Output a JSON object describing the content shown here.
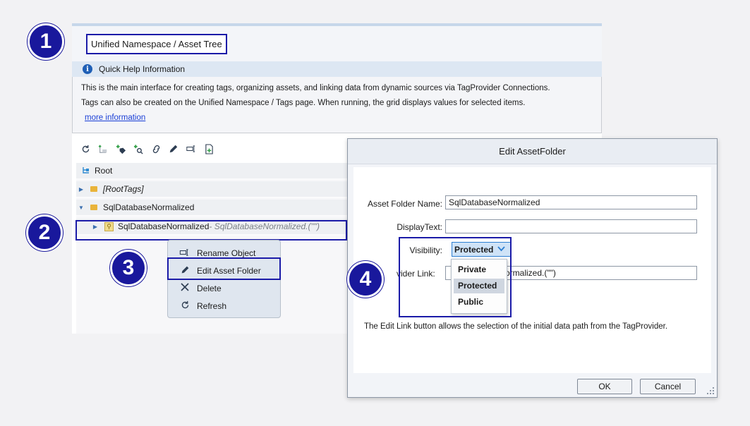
{
  "header": {
    "title": "Unified Namespace / Asset Tree"
  },
  "quick_help": {
    "title": "Quick Help Information",
    "line1": "This is the main interface for creating tags, organizing assets, and linking data from dynamic sources via TagProvider Connections.",
    "line2": "Tags can also be created on the Unified Namespace / Tags page. When running, the grid displays values for selected items.",
    "link": "more information"
  },
  "toolbar": {
    "icons": [
      "refresh-icon",
      "new-folder-icon",
      "add-tag-icon",
      "add-link-icon",
      "unlink-icon",
      "edit-icon",
      "rename-icon",
      "new-document-icon"
    ]
  },
  "tree": {
    "root": "Root",
    "root_tags": "[RootTags]",
    "sql_folder": "SqlDatabaseNormalized",
    "child_name": "SqlDatabaseNormalized",
    "child_link": " - SqlDatabaseNormalized.(\"\")"
  },
  "context_menu": {
    "items": [
      "Rename Object",
      "Edit Asset Folder",
      "Delete",
      "Refresh"
    ]
  },
  "badges": [
    "1",
    "2",
    "3",
    "4"
  ],
  "dialog": {
    "title": "Edit AssetFolder",
    "asset_folder_name_label": "Asset Folder Name:",
    "asset_folder_name_value": "SqlDatabaseNormalized",
    "display_text_label": "DisplayText:",
    "display_text_value": "",
    "visibility_label": "Visibility:",
    "visibility_value": "Protected",
    "visibility_options": [
      "Private",
      "Protected",
      "Public"
    ],
    "provider_link_label": "vider Link:",
    "provider_link_value": "ormalized.(\"\")",
    "help_text": "The Edit Link button allows the selection of the initial data path from the TagProvider.",
    "ok_label": "OK",
    "cancel_label": "Cancel"
  },
  "colors": {
    "highlight": "#1b1ba8",
    "badge": "#19189c",
    "folder": "#e9b43a",
    "accent": "#2d7fd1"
  }
}
